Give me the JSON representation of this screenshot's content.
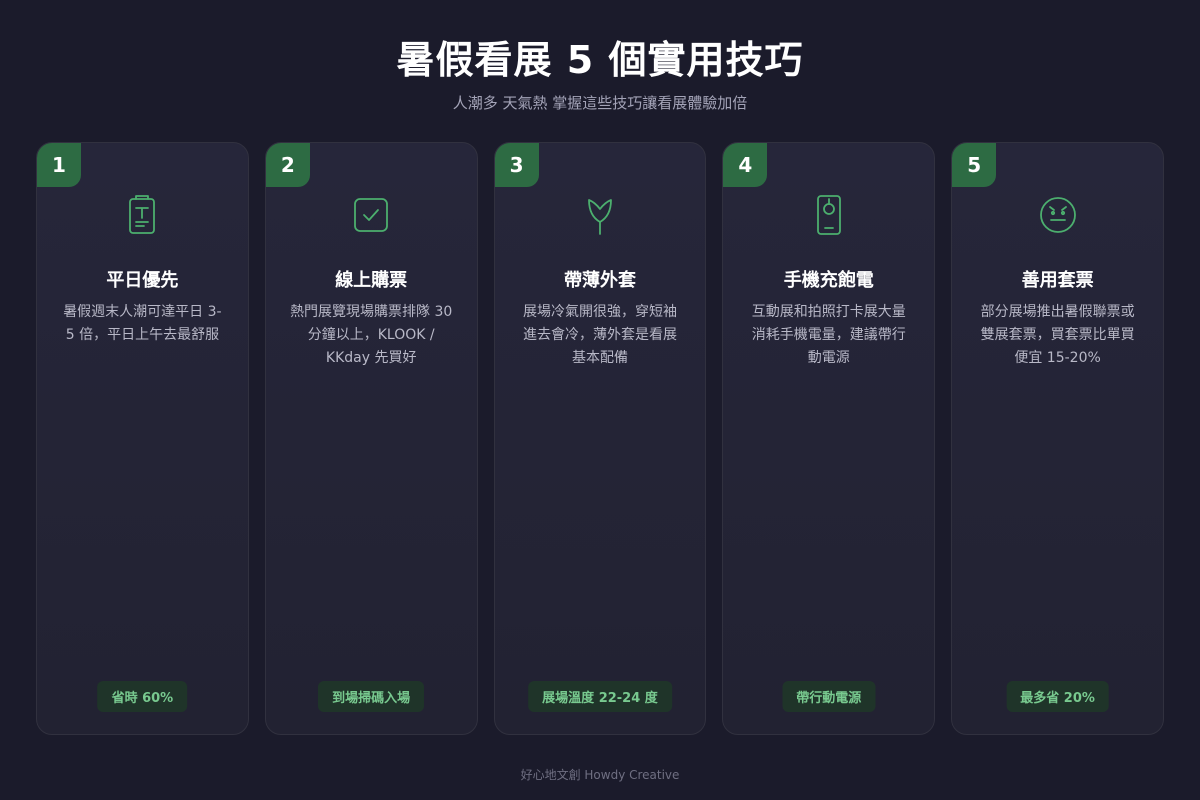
{
  "header": {
    "title": "暑假看展 5 個實用技巧",
    "subtitle": "人潮多 天氣熱 掌握這些技巧讓看展體驗加倍"
  },
  "cards": [
    {
      "number": "1",
      "icon": "ticket-calendar-icon",
      "title": "平日優先",
      "description": "暑假週末人潮可達平日 3-5 倍，平日上午去最舒服",
      "badge": "省時 60%"
    },
    {
      "number": "2",
      "icon": "check-square-icon",
      "title": "線上購票",
      "description": "熱門展覽現場購票排隊 30 分鐘以上，KLOOK / KKday 先買好",
      "badge": "到場掃碼入場"
    },
    {
      "number": "3",
      "icon": "tulip-icon",
      "title": "帶薄外套",
      "description": "展場冷氣開很強，穿短袖進去會冷，薄外套是看展基本配備",
      "badge": "展場溫度 22-24 度"
    },
    {
      "number": "4",
      "icon": "phone-icon",
      "title": "手機充飽電",
      "description": "互動展和拍照打卡展大量消耗手機電量，建議帶行動電源",
      "badge": "帶行動電源"
    },
    {
      "number": "5",
      "icon": "face-icon",
      "title": "善用套票",
      "description": "部分展場推出暑假聯票或雙展套票，買套票比單買便宜 15-20%",
      "badge": "最多省 20%"
    }
  ],
  "footer": {
    "credit": "好心地文創 Howdy Creative"
  },
  "colors": {
    "background": "#1b1b2b",
    "card": "#24243a",
    "accent": "#2d6b43",
    "badge_text": "#78c98f"
  }
}
